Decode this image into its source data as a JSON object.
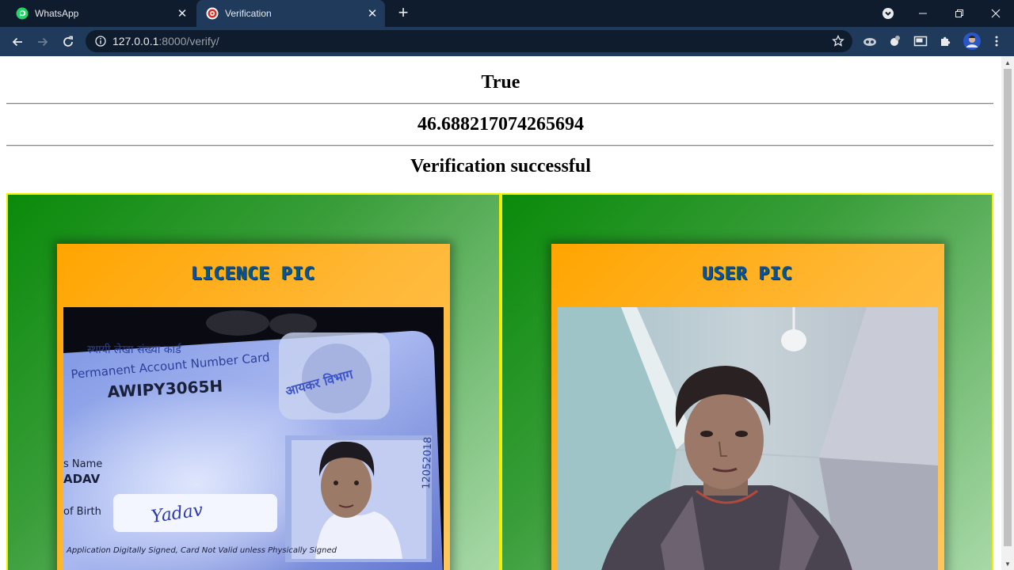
{
  "browser": {
    "tabs": [
      {
        "title": "WhatsApp",
        "icon": "whatsapp-icon",
        "active": false
      },
      {
        "title": "Verification",
        "icon": "site-favicon-icon",
        "active": true
      }
    ],
    "url_host": "127.0.0.1",
    "url_rest": ":8000/verify/",
    "colors": {
      "tabstrip": "#0f1c2e",
      "toolbar": "#1f3a5b"
    }
  },
  "page": {
    "match_result": "True",
    "distance_score": "46.688217074265694",
    "status_message": "Verification successful",
    "panels": {
      "licence": {
        "title": "LICENCE PIC"
      },
      "user": {
        "title": "USER PIC"
      }
    },
    "colors": {
      "panel_border": "#f2f200",
      "card_orange": "#ffa500",
      "title_blue": "#0a4fa8"
    }
  },
  "licence_card_text": {
    "hindi_header": "स्थायी लेखा संख्या कार्ड",
    "header": "Permanent Account Number Card",
    "pan_number": "AWIPY3065H",
    "name_label": "s Name",
    "name_value": "ADAV",
    "birth_label": "of Birth",
    "signature": "Yadav",
    "footer": "Application Digitally Signed, Card Not Valid unless Physically Signed",
    "side_number": "12052018",
    "hologram": "आयकर विभाग"
  }
}
